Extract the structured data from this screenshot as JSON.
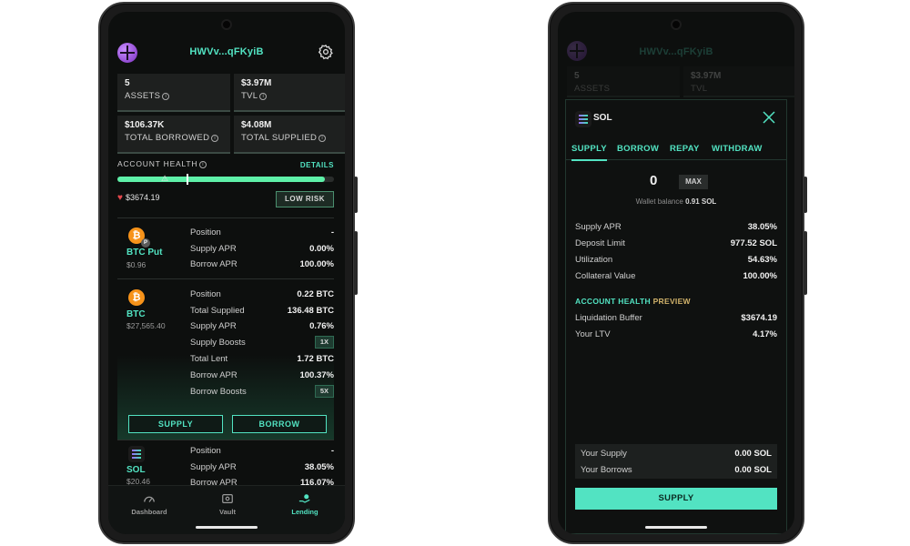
{
  "colors": {
    "accent": "#52e3c2",
    "health_bar": "#5ef0a8",
    "heart": "#e5484d",
    "preview_gold": "#d2b36b"
  },
  "left": {
    "header": {
      "wallet": "HWVv...qFKyiB",
      "logo_icon": "marginfi-logo-icon",
      "settings_icon": "gear-icon"
    },
    "stats": [
      {
        "value": "5",
        "label": "ASSETS"
      },
      {
        "value": "$3.97M",
        "label": "TVL"
      },
      {
        "value": "$106.37K",
        "label": "TOTAL BORROWED"
      },
      {
        "value": "$4.08M",
        "label": "TOTAL SUPPLIED"
      }
    ],
    "account_health": {
      "label": "ACCOUNT HEALTH",
      "details": "DETAILS",
      "health_value": "$3674.19",
      "risk": "LOW RISK",
      "health_fraction": 0.96
    },
    "assets": [
      {
        "name": "BTC Put",
        "price": "$0.96",
        "icon": "btc-icon",
        "badge": "P",
        "rows": [
          {
            "k": "Position",
            "v": "-"
          },
          {
            "k": "Supply APR",
            "v": "0.00%"
          },
          {
            "k": "Borrow APR",
            "v": "100.00%"
          }
        ]
      },
      {
        "name": "BTC",
        "price": "$27,565.40",
        "icon": "btc-icon",
        "rows": [
          {
            "k": "Position",
            "v": "0.22 BTC"
          },
          {
            "k": "Total Supplied",
            "v": "136.48 BTC"
          },
          {
            "k": "Supply APR",
            "v": "0.76%"
          },
          {
            "k": "Supply Boosts",
            "v": "1X"
          },
          {
            "k": "Total Lent",
            "v": "1.72 BTC"
          },
          {
            "k": "Borrow APR",
            "v": "100.37%"
          },
          {
            "k": "Borrow Boosts",
            "v": "5X"
          }
        ],
        "supply_label": "SUPPLY",
        "borrow_label": "BORROW"
      },
      {
        "name": "SOL",
        "price": "$20.46",
        "icon": "sol-icon",
        "rows": [
          {
            "k": "Position",
            "v": "-"
          },
          {
            "k": "Supply APR",
            "v": "38.05%"
          },
          {
            "k": "Borrow APR",
            "v": "116.07%"
          }
        ]
      }
    ],
    "nav": [
      {
        "label": "Dashboard",
        "icon": "gauge-icon",
        "active": false
      },
      {
        "label": "Vault",
        "icon": "vault-icon",
        "active": false
      },
      {
        "label": "Lending",
        "icon": "lending-icon",
        "active": true
      }
    ]
  },
  "right": {
    "modal": {
      "asset": "SOL",
      "tabs": [
        "SUPPLY",
        "BORROW",
        "REPAY",
        "WITHDRAW"
      ],
      "active_tab": "SUPPLY",
      "amount": "0",
      "max_label": "MAX",
      "wallet_balance_label": "Wallet balance",
      "wallet_balance_value": "0.91 SOL",
      "rows": [
        {
          "k": "Supply APR",
          "v": "38.05%"
        },
        {
          "k": "Deposit Limit",
          "v": "977.52 SOL"
        },
        {
          "k": "Utilization",
          "v": "54.63%"
        },
        {
          "k": "Collateral Value",
          "v": "100.00%"
        }
      ],
      "preview_title_a": "ACCOUNT HEALTH",
      "preview_title_b": "PREVIEW",
      "preview_rows": [
        {
          "k": "Liquidation Buffer",
          "v": "$3674.19"
        },
        {
          "k": "Your LTV",
          "v": "4.17%"
        }
      ],
      "summary_rows": [
        {
          "k": "Your Supply",
          "v": "0.00 SOL"
        },
        {
          "k": "Your Borrows",
          "v": "0.00 SOL"
        }
      ],
      "cta": "SUPPLY"
    }
  }
}
